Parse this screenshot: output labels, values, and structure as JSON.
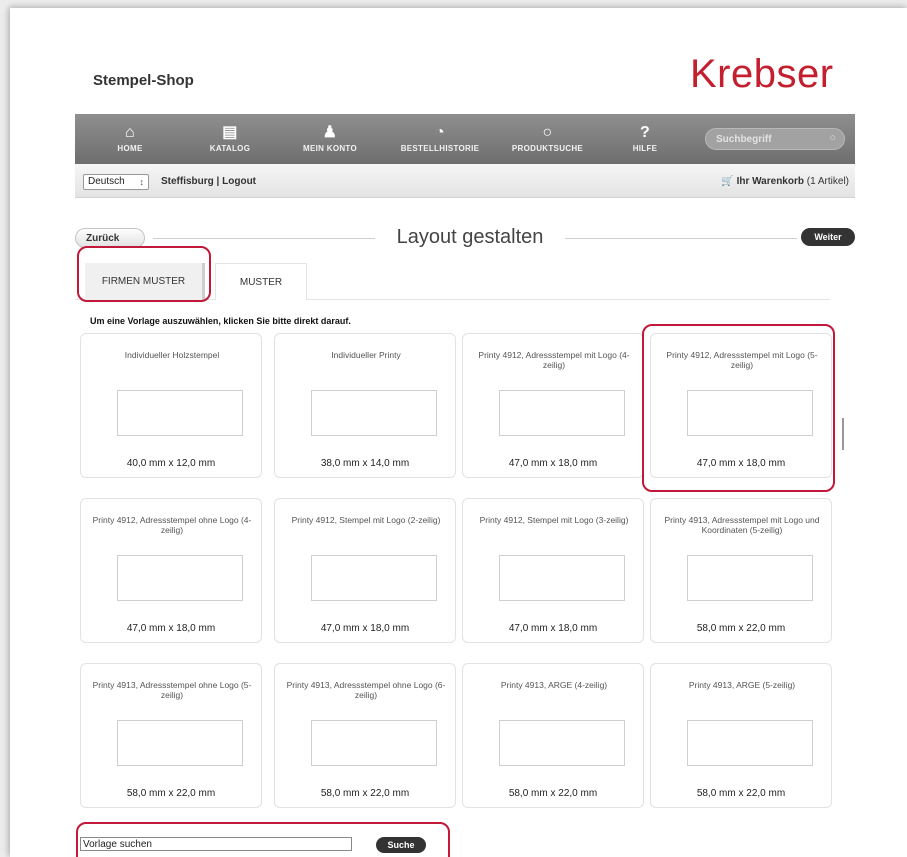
{
  "header": {
    "shop_title": "Stempel-Shop",
    "logo": "Krebser",
    "brand_color": "#c41f2e"
  },
  "nav": {
    "items": [
      {
        "label": "HOME",
        "icon": "home-icon"
      },
      {
        "label": "KATALOG",
        "icon": "book-icon"
      },
      {
        "label": "MEIN KONTO",
        "icon": "user-icon"
      },
      {
        "label": "BESTELLHISTORIE",
        "icon": "clock-icon"
      },
      {
        "label": "PRODUKTSUCHE",
        "icon": "search-icon"
      },
      {
        "label": "HILFE",
        "icon": "help-icon"
      }
    ],
    "search_placeholder": "Suchbegriff"
  },
  "subbar": {
    "language": "Deutsch",
    "user_links": "Steffisburg | Logout",
    "cart_label": "Ihr Warenkorb",
    "cart_count": "(1 Artikel)"
  },
  "title_row": {
    "back": "Zurück",
    "title": "Layout gestalten",
    "next": "Weiter"
  },
  "tabs": [
    {
      "label": "FIRMEN MUSTER"
    },
    {
      "label": "MUSTER"
    }
  ],
  "instruction": "Um eine Vorlage auszuwählen, klicken Sie bitte direkt darauf.",
  "templates": [
    {
      "title": "Individueller Holzstempel",
      "size": "40,0 mm x 12,0 mm"
    },
    {
      "title": "Individueller Printy",
      "size": "38,0 mm x 14,0 mm"
    },
    {
      "title": "Printy 4912, Adressstempel mit Logo (4-zeilig)",
      "size": "47,0 mm x 18,0 mm"
    },
    {
      "title": "Printy 4912, Adressstempel mit Logo (5-zeilig)",
      "size": "47,0 mm x 18,0 mm"
    },
    {
      "title": "Printy 4912, Adressstempel ohne Logo (4-zeilig)",
      "size": "47,0 mm x 18,0 mm"
    },
    {
      "title": "Printy 4912, Stempel mit Logo (2-zeilig)",
      "size": "47,0 mm x 18,0 mm"
    },
    {
      "title": "Printy 4912, Stempel mit Logo (3-zeilig)",
      "size": "47,0 mm x 18,0 mm"
    },
    {
      "title": "Printy 4913, Adressstempel mit Logo und Koordinaten (5-zeilig)",
      "size": "58,0 mm x 22,0 mm"
    },
    {
      "title": "Printy 4913, Adressstempel ohne Logo (5-zeilig)",
      "size": "58,0 mm x 22,0 mm"
    },
    {
      "title": "Printy 4913, Adressstempel ohne Logo (6-zeilig)",
      "size": "58,0 mm x 22,0 mm"
    },
    {
      "title": "Printy 4913, ARGE (4-zeilig)",
      "size": "58,0 mm x 22,0 mm"
    },
    {
      "title": "Printy 4913, ARGE (5-zeilig)",
      "size": "58,0 mm x 22,0 mm"
    }
  ],
  "search": {
    "value": "Vorlage suchen",
    "button": "Suche"
  },
  "highlight_color": "#c2183a"
}
